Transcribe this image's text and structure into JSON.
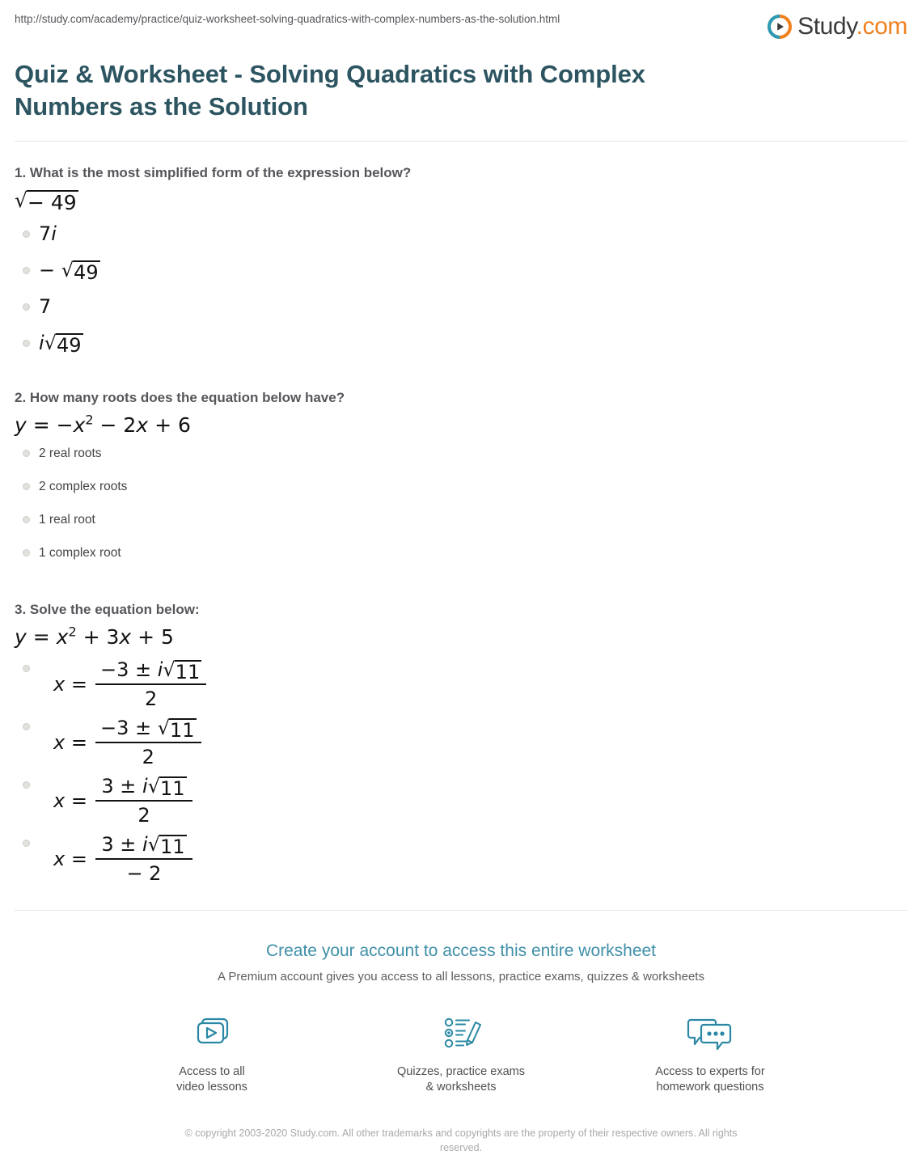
{
  "header": {
    "url": "http://study.com/academy/practice/quiz-worksheet-solving-quadratics-with-complex-numbers-as-the-solution.html",
    "logo_text": "Study",
    "logo_suffix": ".com",
    "logo_icon": "play-circle-icon",
    "title": "Quiz & Worksheet - Solving Quadratics with Complex Numbers as the Solution"
  },
  "questions": [
    {
      "number": "1.",
      "prompt": "What is the most simplified form of the expression below?",
      "equation_plain": "√(−49)",
      "equation": {
        "radicand": "− 49"
      },
      "option_style": "math",
      "options": [
        {
          "text": "7i",
          "parts": [
            {
              "t": "7"
            },
            {
              "t": "i",
              "italic": true
            }
          ]
        },
        {
          "text": "−√49",
          "parts": [
            {
              "t": "− "
            },
            {
              "radical": "49"
            }
          ]
        },
        {
          "text": "7",
          "parts": [
            {
              "t": "7"
            }
          ]
        },
        {
          "text": "i√49",
          "parts": [
            {
              "t": "i",
              "italic": true
            },
            {
              "radical": "49"
            }
          ]
        }
      ]
    },
    {
      "number": "2.",
      "prompt": "How many roots does the equation below have?",
      "equation_plain": "y = −x² − 2x + 6",
      "option_style": "plain",
      "options": [
        {
          "text": "2 real roots"
        },
        {
          "text": "2 complex roots"
        },
        {
          "text": "1 real root"
        },
        {
          "text": "1 complex root"
        }
      ]
    },
    {
      "number": "3.",
      "prompt": "Solve the equation below:",
      "equation_plain": "y = x² + 3x + 5",
      "option_style": "fraction",
      "options": [
        {
          "lhs": "x =",
          "numerator": "−3 ± i√11",
          "num_prefix": "− 3 ± ",
          "num_i": "i",
          "num_radical": "11",
          "denominator": "2"
        },
        {
          "lhs": "x =",
          "numerator": "−3 ± √11",
          "num_prefix": "− 3 ± ",
          "num_i": "",
          "num_radical": "11",
          "denominator": "2"
        },
        {
          "lhs": "x =",
          "numerator": "3 ± i√11",
          "num_prefix": "3 ± ",
          "num_i": "i",
          "num_radical": "11",
          "denominator": "2"
        },
        {
          "lhs": "x =",
          "numerator": "3 ± i√11",
          "num_prefix": "3 ± ",
          "num_i": "i",
          "num_radical": "11",
          "denominator": "− 2"
        }
      ]
    }
  ],
  "cta": {
    "headline": "Create your account to access this entire worksheet",
    "subtext": "A Premium account gives you access to all lessons, practice exams, quizzes & worksheets",
    "accent_color": "#3f8fa8",
    "features": [
      {
        "icon": "video-lessons-icon",
        "label": "Access to all\nvideo lessons"
      },
      {
        "icon": "quiz-worksheet-pencil-icon",
        "label": "Quizzes, practice exams\n& worksheets"
      },
      {
        "icon": "speech-bubbles-icon",
        "label": "Access to experts for\nhomework questions"
      }
    ]
  },
  "footer": {
    "copyright": "© copyright 2003-2020 Study.com. All other trademarks and copyrights are the property of their respective owners. All rights reserved."
  }
}
